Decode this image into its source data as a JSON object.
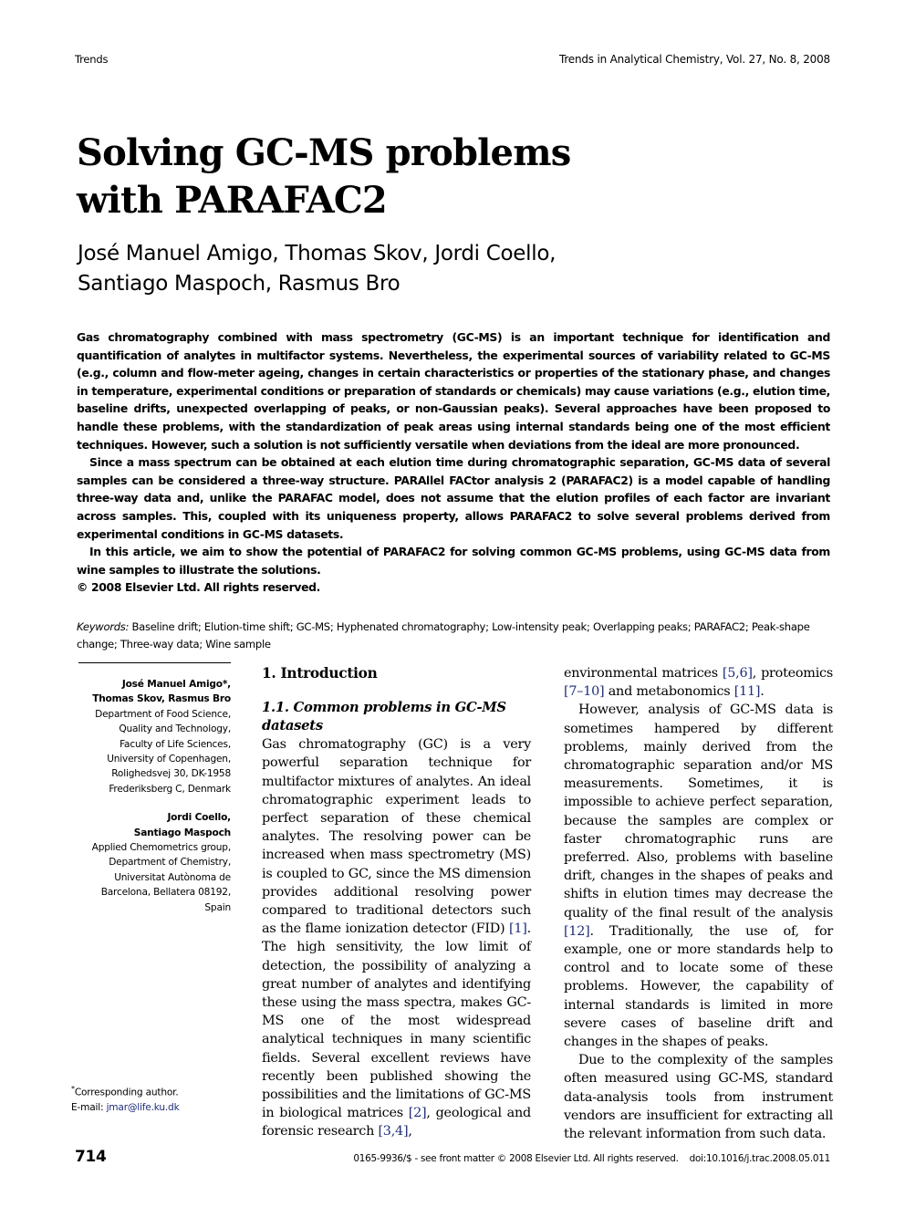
{
  "running_head": {
    "left": "Trends",
    "right": "Trends in Analytical Chemistry, Vol. 27, No. 8, 2008"
  },
  "title": {
    "line1": "Solving GC-MS problems",
    "line2": "with PARAFAC2"
  },
  "authors": {
    "line1": "José Manuel Amigo, Thomas Skov, Jordi Coello,",
    "line2": "Santiago Maspoch, Rasmus Bro"
  },
  "abstract": {
    "p1": "Gas chromatography combined with mass spectrometry (GC-MS) is an important technique for identification and quantification of analytes in multifactor systems. Nevertheless, the experimental sources of variability related to GC-MS (e.g., column and flow-meter ageing, changes in certain characteristics or properties of the stationary phase, and changes in temperature, experimental conditions or preparation of standards or chemicals) may cause variations (e.g., elution time, baseline drifts, unexpected overlapping of peaks, or non-Gaussian peaks). Several approaches have been proposed to handle these problems, with the standardization of peak areas using internal standards being one of the most efficient techniques. However, such a solution is not sufficiently versatile when deviations from the ideal are more pronounced.",
    "p2": "Since a mass spectrum can be obtained at each elution time during chromatographic separation, GC-MS data of several samples can be considered a three-way structure. PARAllel FACtor analysis 2 (PARAFAC2) is a model capable of handling three-way data and, unlike the PARAFAC model, does not assume that the elution profiles of each factor are invariant across samples. This, coupled with its uniqueness property, allows PARAFAC2 to solve several problems derived from experimental conditions in GC-MS datasets.",
    "p3": "In this article, we aim to show the potential of PARAFAC2 for solving common GC-MS problems, using GC-MS data from wine samples to illustrate the solutions.",
    "copyright": "© 2008 Elsevier Ltd. All rights reserved."
  },
  "keywords": {
    "label": "Keywords:",
    "text": " Baseline drift; Elution-time shift; GC-MS; Hyphenated chromatography; Low-intensity peak; Overlapping peaks; PARAFAC2; Peak-shape change; Three-way data; Wine sample"
  },
  "affiliations": [
    {
      "names_line1": "José Manuel Amigo*,",
      "names_line2": "Thomas Skov, Rasmus Bro",
      "lines": [
        "Department of Food Science,",
        "Quality and Technology,",
        "Faculty of Life Sciences,",
        "University of Copenhagen,",
        "Rolighedsvej 30, DK-1958",
        "Frederiksberg C, Denmark"
      ]
    },
    {
      "names_line1": "Jordi Coello,",
      "names_line2": "Santiago Maspoch",
      "lines": [
        "Applied Chemometrics group,",
        "Department of Chemistry,",
        "Universitat Autònoma de",
        "Barcelona, Bellatera 08192,",
        "Spain"
      ]
    }
  ],
  "corresponding": {
    "line1": "Corresponding author.",
    "email_label": "E-mail: ",
    "email": "jmar@life.ku.dk"
  },
  "sections": {
    "intro_heading": "1. Introduction",
    "subsection_heading": "1.1. Common problems in GC-MS datasets"
  },
  "body": {
    "mid_p1_a": "Gas chromatography (GC) is a very powerful separation technique for multifactor mixtures of analytes. An ideal chromatographic experiment leads to perfect separation of these chemical analytes. The resolving power can be increased when mass spectrometry (MS) is coupled to GC, since the MS dimension provides additional resolving power compared to traditional detectors such as the flame ionization detector (FID) ",
    "mid_ref1": "[1]",
    "mid_p1_b": ". The high sensitivity, the low limit of detection, the possibility of analyzing a great number of analytes and identifying these using the mass spectra, makes GC-MS one of the most widespread analytical techniques in many scientific fields. Several excellent reviews have recently been published showing the possibilities and the limitations of GC-MS in biological matrices ",
    "mid_ref2": "[2]",
    "mid_p1_c": ", geological and forensic research ",
    "mid_ref3": "[3,4]",
    "mid_p1_d": ",",
    "right_p1_a": "environmental matrices ",
    "right_ref1": "[5,6]",
    "right_p1_b": ", proteomics ",
    "right_ref2": "[7–10]",
    "right_p1_c": " and metabonomics ",
    "right_ref3": "[11]",
    "right_p1_d": ".",
    "right_p2_a": "However, analysis of GC-MS data is sometimes hampered by different problems, mainly derived from the chromatographic separation and/or MS measurements. Sometimes, it is impossible to achieve perfect separation, because the samples are complex or faster chromatographic runs are preferred. Also, problems with baseline drift, changes in the shapes of peaks and shifts in elution times may decrease the quality of the final result of the analysis ",
    "right_ref4": "[12]",
    "right_p2_b": ". Traditionally, the use of, for example, one or more standards help to control and to locate some of these problems. However, the capability of internal standards is limited in more severe cases of baseline drift and changes in the shapes of peaks.",
    "right_p3": "Due to the complexity of the samples often measured using GC-MS, standard data-analysis tools from instrument vendors are insufficient for extracting all the relevant information from such data."
  },
  "footer": {
    "page_number": "714",
    "imprint": "0165-9936/$ - see front matter © 2008 Elsevier Ltd. All rights reserved.",
    "doi": "doi:10.1016/j.trac.2008.05.011"
  },
  "colors": {
    "reference_link": "#1f2d7a",
    "text": "#000000",
    "background": "#ffffff"
  }
}
